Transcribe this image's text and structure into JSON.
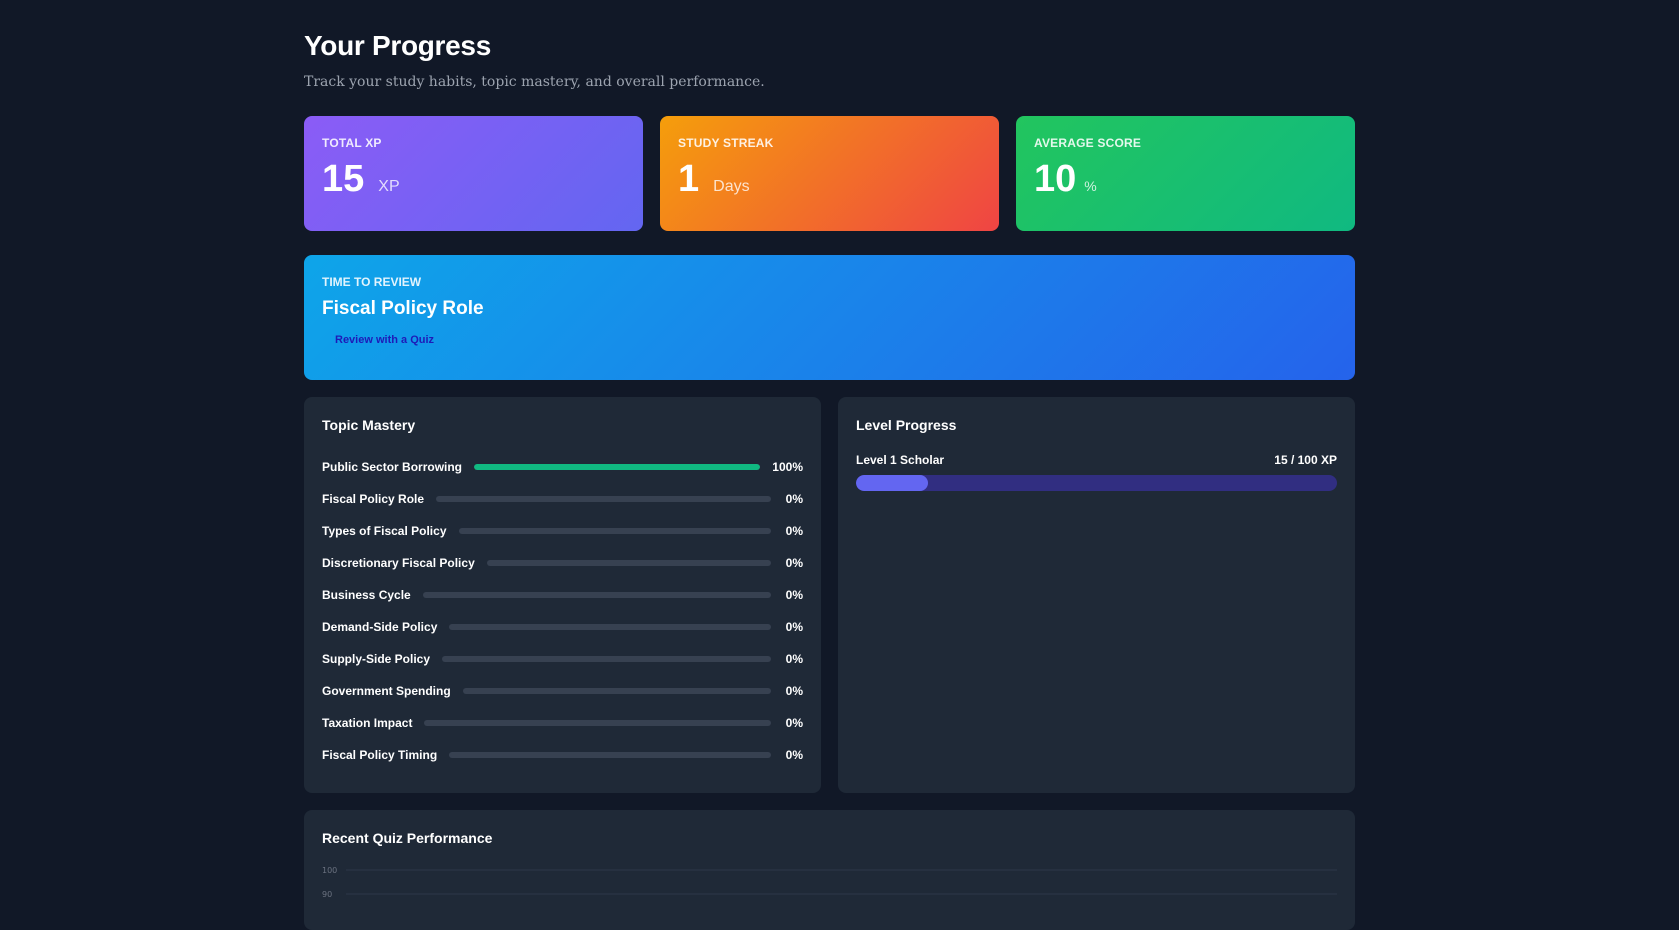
{
  "header": {
    "title": "Your Progress",
    "subtitle": "Track your study habits, topic mastery, and overall performance."
  },
  "stats": {
    "xp": {
      "label": "TOTAL XP",
      "value": "15",
      "unit": "XP"
    },
    "streak": {
      "label": "STUDY STREAK",
      "value": "1",
      "unit": "Days"
    },
    "score": {
      "label": "AVERAGE SCORE",
      "value": "10",
      "unit": "%"
    }
  },
  "review": {
    "label": "TIME TO REVIEW",
    "topic": "Fiscal Policy Role",
    "button_label": "Review with a Quiz"
  },
  "mastery": {
    "title": "Topic Mastery",
    "topics": [
      {
        "name": "Public Sector Borrowing",
        "percent": 100,
        "percent_label": "100%"
      },
      {
        "name": "Fiscal Policy Role",
        "percent": 0,
        "percent_label": "0%"
      },
      {
        "name": "Types of Fiscal Policy",
        "percent": 0,
        "percent_label": "0%"
      },
      {
        "name": "Discretionary Fiscal Policy",
        "percent": 0,
        "percent_label": "0%"
      },
      {
        "name": "Business Cycle",
        "percent": 0,
        "percent_label": "0%"
      },
      {
        "name": "Demand-Side Policy",
        "percent": 0,
        "percent_label": "0%"
      },
      {
        "name": "Supply-Side Policy",
        "percent": 0,
        "percent_label": "0%"
      },
      {
        "name": "Government Spending",
        "percent": 0,
        "percent_label": "0%"
      },
      {
        "name": "Taxation Impact",
        "percent": 0,
        "percent_label": "0%"
      },
      {
        "name": "Fiscal Policy Timing",
        "percent": 0,
        "percent_label": "0%"
      }
    ]
  },
  "level": {
    "title": "Level Progress",
    "name": "Level 1 Scholar",
    "xp_label": "15 / 100 XP",
    "progress_fraction": 0.15
  },
  "quiz_performance": {
    "title": "Recent Quiz Performance",
    "y_ticks": [
      "100",
      "90"
    ]
  },
  "colors": {
    "background": "#111827",
    "panel": "#1f2937",
    "mastery_fill": "#10b981",
    "level_fill": "#6366f1",
    "level_track": "#312e81"
  }
}
